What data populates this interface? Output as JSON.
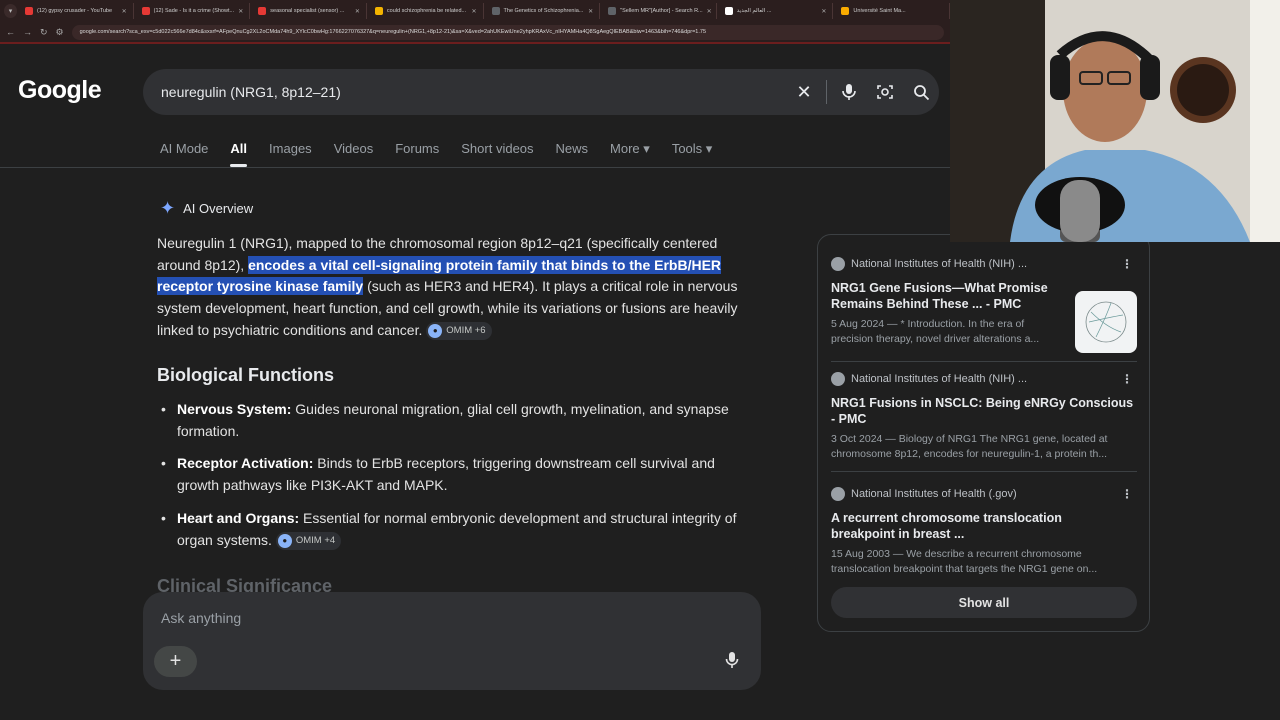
{
  "browser": {
    "tabs": [
      {
        "label": "(12) gypsy crusader - YouTube",
        "color": "#e53935"
      },
      {
        "label": "(12) Sade - Is it a crime (Showt...",
        "color": "#e53935"
      },
      {
        "label": "seasonal specialist (sensor) ...",
        "color": "#e53935"
      },
      {
        "label": "could schizophrenia be related...",
        "color": "#f4b400"
      },
      {
        "label": "The Genetics of Schizophrenia...",
        "color": "#5f6368"
      },
      {
        "label": "\"Sellem MR\"[Author] - Search R...",
        "color": "#5f6368"
      },
      {
        "label": "العالم الجديد ...",
        "color": "#ffffff"
      },
      {
        "label": "Université Saint Ma...",
        "color": "#f9ab00"
      }
    ],
    "url": "google.com/search?sca_esv=c5d022c566e7d84c&sxsrf=AFpeQnuCg2XL2oCMda74h9_XYlcC0bwHg:1766227076327&q=neuregulin+(NRG1,+8p12-21)&sa=X&ved=2ahUKEwiUne2yhpKRAxVc_nIHYAMHa4Q8SgAegQIEBAB&biw=1463&bih=746&dpr=1.75"
  },
  "google": {
    "logo": "Google",
    "query": "neuregulin (NRG1, 8p12–21)",
    "tabs": [
      "AI Mode",
      "All",
      "Images",
      "Videos",
      "Forums",
      "Short videos",
      "News",
      "More ▾",
      "Tools ▾"
    ]
  },
  "ai_overview": {
    "heading": "AI Overview",
    "intro_part1": "Neuregulin 1 (NRG1), mapped to the chromosomal region 8p12–q21 (specifically centered around 8p12), ",
    "intro_highlight": "encodes a vital cell-signaling protein family that binds to the ErbB/HER receptor tyrosine kinase family",
    "intro_part2": " (such as HER3 and HER4). It plays a critical role in nervous system development, heart function, and cell growth, while its variations or fusions are heavily linked to psychiatric conditions and cancer. ",
    "intro_chip": "OMIM +6",
    "section_title": "Biological Functions",
    "functions": [
      {
        "term": "Nervous System:",
        "text": " Guides neuronal migration, glial cell growth, myelination, and synapse formation."
      },
      {
        "term": "Receptor Activation:",
        "text": " Binds to ErbB receptors, triggering downstream cell survival and growth pathways like PI3K-AKT and MAPK."
      },
      {
        "term": "Heart and Organs:",
        "text": " Essential for normal embryonic development and structural integrity of organ systems. ",
        "chip": "OMIM +4"
      }
    ],
    "next_section": "Clinical Significance"
  },
  "ask": {
    "placeholder": "Ask anything"
  },
  "sources": [
    {
      "site": "National Institutes of Health (NIH) ...",
      "title": "NRG1 Gene Fusions—What Promise Remains Behind These ... - PMC",
      "snippet": "5 Aug 2024 — * Introduction. In the era of precision therapy, novel driver alterations a..."
    },
    {
      "site": "National Institutes of Health (NIH) ...",
      "title": "NRG1 Fusions in NSCLC: Being eNRGy Conscious - PMC",
      "snippet": "3 Oct 2024 — Biology of NRG1 The NRG1 gene, located at chromosome 8p12, encodes for neuregulin-1, a protein th..."
    },
    {
      "site": "National Institutes of Health (.gov)",
      "title": "A recurrent chromosome translocation breakpoint in breast ...",
      "snippet": "15 Aug 2003 — We describe a recurrent chromosome translocation breakpoint that targets the NRG1 gene on..."
    }
  ],
  "show_all": "Show all"
}
